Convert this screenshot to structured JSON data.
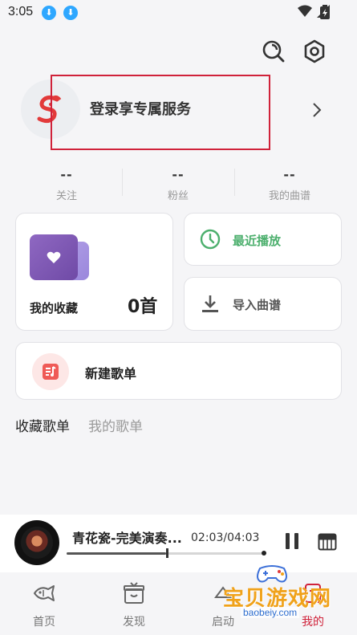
{
  "status_bar": {
    "time": "3:05"
  },
  "login": {
    "text": "登录享专属服务"
  },
  "stats": [
    {
      "value": "--",
      "label": "关注"
    },
    {
      "value": "--",
      "label": "粉丝"
    },
    {
      "value": "--",
      "label": "我的曲谱"
    }
  ],
  "favorites_card": {
    "label": "我的收藏",
    "count": "0首"
  },
  "recent_card": {
    "label": "最近播放"
  },
  "import_card": {
    "label": "导入曲谱"
  },
  "new_playlist": {
    "label": "新建歌单"
  },
  "playlist_tabs": [
    {
      "label": "收藏歌单",
      "active": true
    },
    {
      "label": "我的歌单",
      "active": false
    }
  ],
  "player": {
    "title": "青花瓷-完美演奏...",
    "time": "02:03/04:03",
    "progress": 0.506
  },
  "bottom_nav": [
    {
      "label": "首页",
      "icon": "fish-icon",
      "active": false
    },
    {
      "label": "发现",
      "icon": "gift-box-icon",
      "active": false
    },
    {
      "label": "启动",
      "icon": "launch-icon",
      "active": false
    },
    {
      "label": "我的",
      "icon": "profile-icon",
      "active": true
    }
  ],
  "watermark": {
    "text": "宝贝游戏网",
    "url": "baobeiy.com"
  },
  "colors": {
    "accent_red": "#d0223a",
    "recent_green": "#4caf6d",
    "download_blue": "#2ea7ff",
    "favorites_purple": "#7b55b2"
  }
}
